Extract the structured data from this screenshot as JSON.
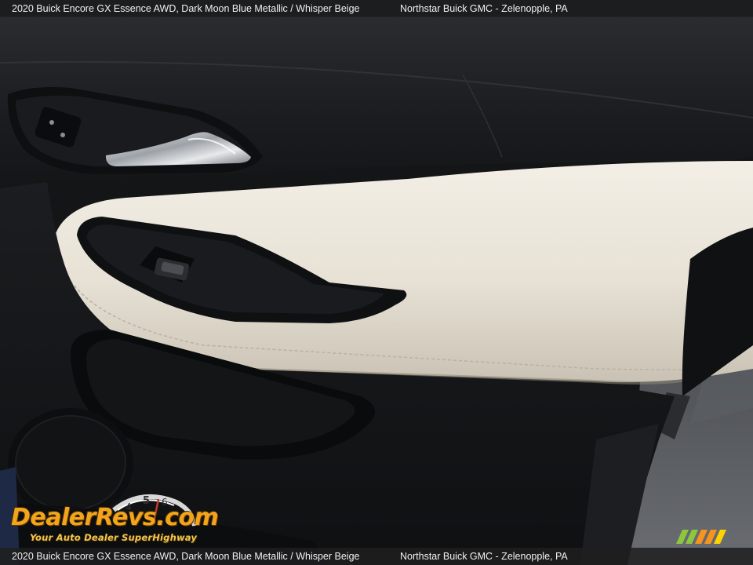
{
  "caption": {
    "vehicle": "2020 Buick Encore GX Essence AWD,  Dark Moon Blue Metallic / Whisper Beige",
    "dealer": "Northstar Buick GMC - Zelenopple, PA"
  },
  "watermark": {
    "brand": "DealerRevs.com",
    "tagline": "Your Auto Dealer SuperHighway"
  },
  "colors": {
    "bar_bg": "#1e1e20",
    "leather_beige": "#e8e3d8",
    "door_black": "#16171a",
    "brand_orange": "#f2a51b"
  }
}
